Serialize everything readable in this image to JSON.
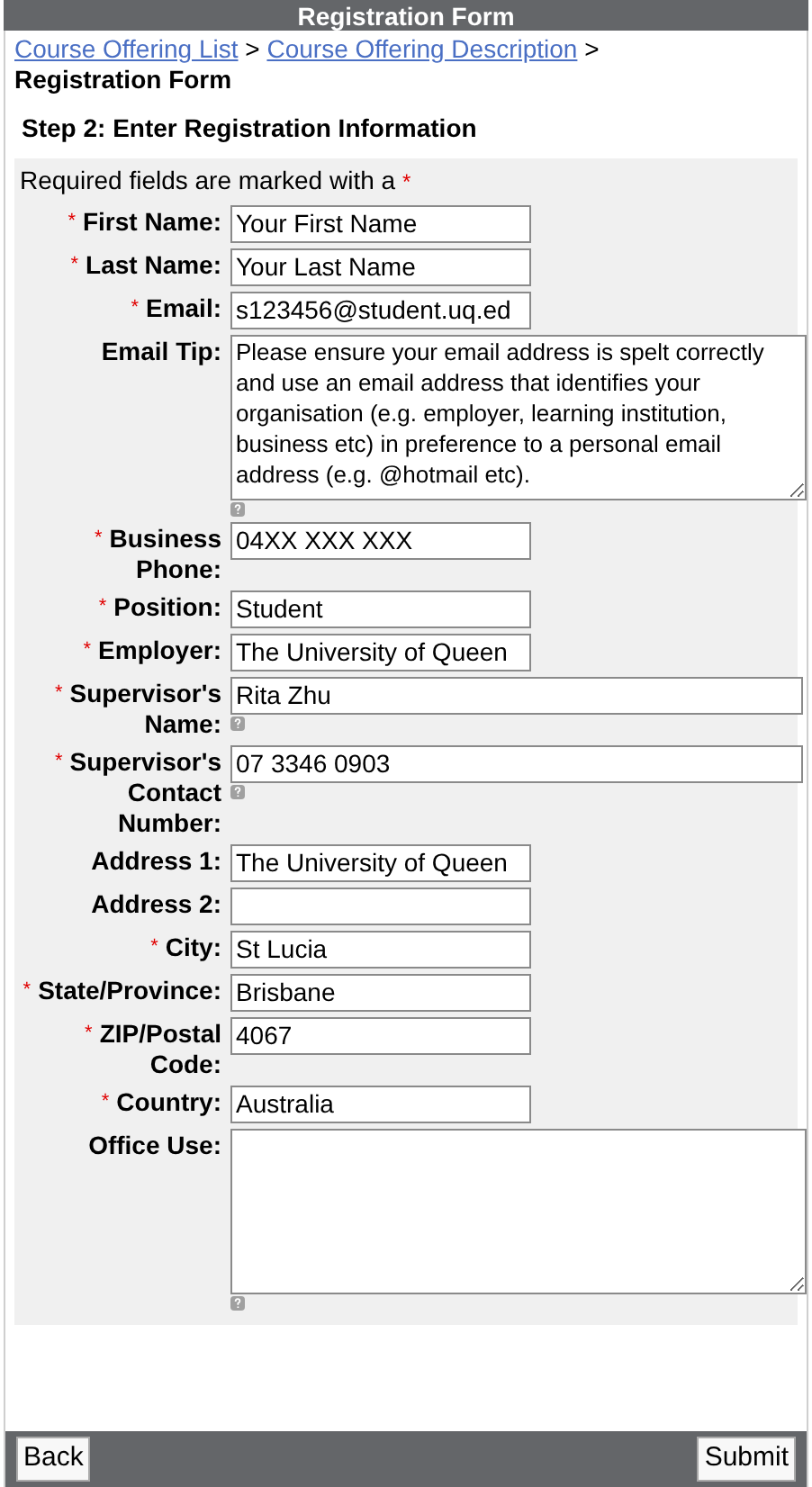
{
  "header": {
    "title": "Registration Form"
  },
  "breadcrumb": {
    "links": [
      "Course Offering List",
      "Course Offering Description"
    ],
    "separator": ">",
    "current": "Registration Form"
  },
  "step_title": "Step 2: Enter Registration Information",
  "required_note": {
    "text": "Required fields are marked with a",
    "marker": "*"
  },
  "fields": [
    {
      "label": "First Name:",
      "required": true,
      "kind": "short",
      "value": "Your First Name",
      "help": false
    },
    {
      "label": "Last Name:",
      "required": true,
      "kind": "short",
      "value": "Your Last Name",
      "help": false
    },
    {
      "label": "Email:",
      "required": true,
      "kind": "short",
      "value": "s123456@student.uq.ed",
      "help": false
    },
    {
      "label": "Email Tip:",
      "required": false,
      "kind": "textarea",
      "value": "Please ensure your email address is spelt correctly and use an email address that identifies your organisation (e.g. employer, learning institution, business etc) in preference to a personal email address (e.g. @hotmail etc).",
      "help": true
    },
    {
      "label": "Business Phone:",
      "required": true,
      "kind": "short",
      "value": "04XX XXX XXX",
      "help": false
    },
    {
      "label": "Position:",
      "required": true,
      "kind": "short",
      "value": "Student",
      "help": false
    },
    {
      "label": "Employer:",
      "required": true,
      "kind": "short",
      "value": "The University of Queen",
      "help": false
    },
    {
      "label": "Supervisor's Name:",
      "required": true,
      "kind": "wide",
      "value": "Rita Zhu",
      "help": true
    },
    {
      "label": "Supervisor's Contact Number:",
      "required": true,
      "kind": "wide",
      "value": "07 3346 0903",
      "help": true
    },
    {
      "label": "Address 1:",
      "required": false,
      "kind": "short",
      "value": "The University of Queen",
      "help": false
    },
    {
      "label": "Address 2:",
      "required": false,
      "kind": "short",
      "help": false
    },
    {
      "label": "City:",
      "required": true,
      "kind": "short",
      "value": "St Lucia",
      "help": false
    },
    {
      "label": "State/Province:",
      "required": true,
      "kind": "short",
      "value": "Brisbane",
      "help": false
    },
    {
      "label": "ZIP/Postal Code:",
      "required": true,
      "kind": "short",
      "value": "4067",
      "help": false
    },
    {
      "label": "Country:",
      "required": true,
      "kind": "short",
      "value": "Australia",
      "help": false
    },
    {
      "label": "Office Use:",
      "required": false,
      "kind": "textarea",
      "help": true
    }
  ],
  "footer": {
    "back": "Back",
    "submit": "Submit"
  }
}
